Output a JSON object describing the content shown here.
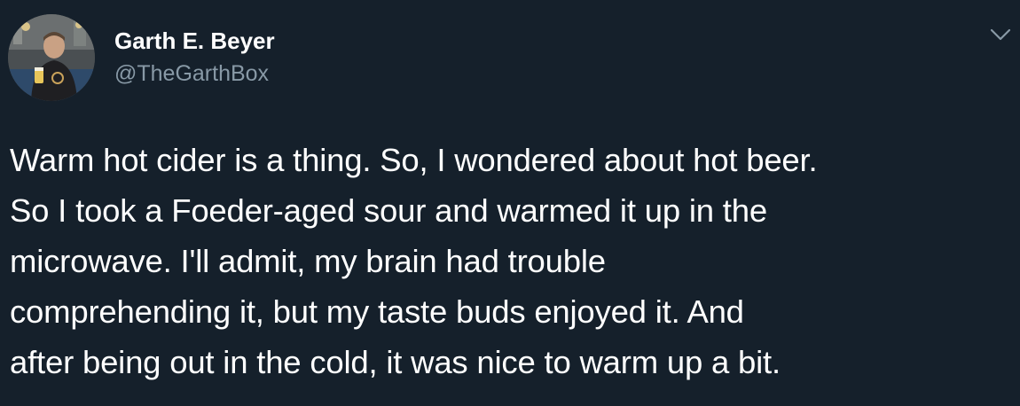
{
  "author": {
    "name": "Garth E. Beyer",
    "handle": "@TheGarthBox",
    "avatar_icon": "user-avatar-photo"
  },
  "menu": {
    "icon": "chevron-down-icon"
  },
  "tweet": {
    "lines": [
      "Warm hot cider is a thing. So, I wondered about hot beer.",
      "So I took a Foeder-aged sour and warmed it up in the",
      "microwave. I'll admit, my brain had trouble",
      "comprehending it, but my taste buds enjoyed it. And",
      "after being out in the cold, it was nice to warm up a bit."
    ]
  },
  "colors": {
    "background": "#15202b",
    "text": "#ffffff",
    "secondary_text": "#8899a6"
  }
}
